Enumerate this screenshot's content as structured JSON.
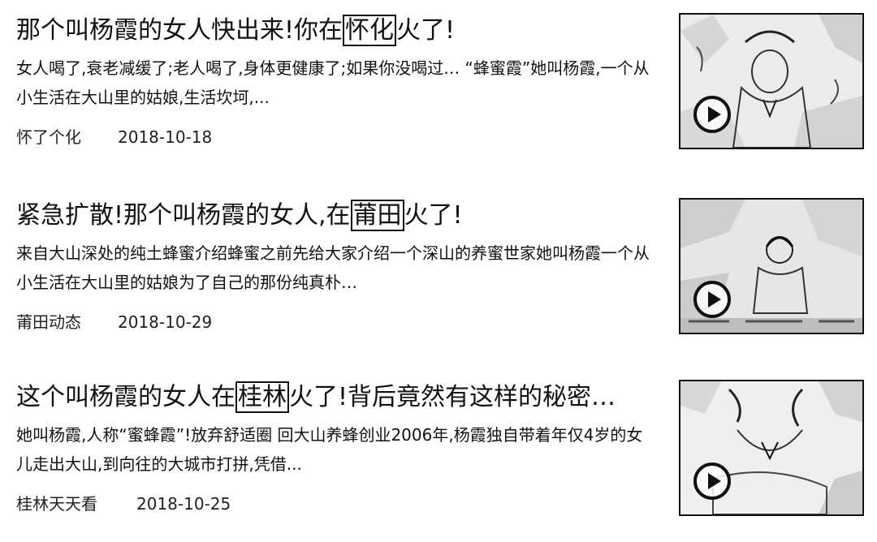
{
  "items": [
    {
      "title_pre": "那个叫杨霞的女人快出来!你在",
      "title_place": "怀化",
      "title_post": "火了!",
      "snippet": "女人喝了,衰老减缓了;老人喝了,身体更健康了;如果你没喝过… “蜂蜜霞”她叫杨霞,一个从小生活在大山里的姑娘,生活坎坷,...",
      "source": "怀了个化",
      "date": "2018-10-18",
      "thumb_icon": "video-thumbnail",
      "play_icon": "play-icon"
    },
    {
      "title_pre": "紧急扩散!那个叫杨霞的女人,在",
      "title_place": "莆田",
      "title_post": "火了!",
      "snippet": "来自大山深处的纯土蜂蜜介绍蜂蜜之前先给大家介绍一个深山的养蜜世家她叫杨霞一个从小生活在大山里的姑娘为了自己的那份纯真朴…",
      "source": "莆田动态",
      "date": "2018-10-29",
      "thumb_icon": "video-thumbnail",
      "play_icon": "play-icon"
    },
    {
      "title_pre": "这个叫杨霞的女人在",
      "title_place": "桂林",
      "title_post": "火了!背后竟然有这样的秘密…",
      "snippet": "她叫杨霞,人称“蜜蜂霞”!放弃舒适圈 回大山养蜂创业2006年,杨霞独自带着年仅4岁的女儿走出大山,到向往的大城市打拼,凭借...",
      "source": "桂林天天看",
      "date": "2018-10-25",
      "thumb_icon": "video-thumbnail",
      "play_icon": "play-icon"
    }
  ]
}
